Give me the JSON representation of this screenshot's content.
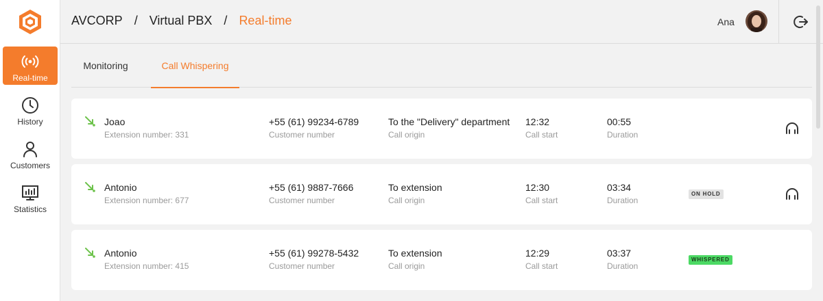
{
  "sidebar": {
    "logo": "avcorp-hexagon-logo",
    "items": [
      {
        "label": "Real-time",
        "icon": "broadcast-icon",
        "active": true
      },
      {
        "label": "History",
        "icon": "clock-icon",
        "active": false
      },
      {
        "label": "Customers",
        "icon": "user-icon",
        "active": false
      },
      {
        "label": "Statistics",
        "icon": "chart-monitor-icon",
        "active": false
      }
    ]
  },
  "header": {
    "breadcrumb": [
      "AVCORP",
      "Virtual PBX",
      "Real-time"
    ],
    "separator": "/",
    "user_name": "Ana",
    "logout_icon": "logout-icon"
  },
  "tabs": [
    {
      "label": "Monitoring",
      "active": false
    },
    {
      "label": "Call Whispering",
      "active": true
    }
  ],
  "calls": [
    {
      "name": "Joao",
      "extension": "Extension number: 331",
      "number": "+55 (61) 99234-6789",
      "number_label": "Customer number",
      "origin": "To the \"Delivery\" department",
      "origin_label": "Call origin",
      "start": "12:32",
      "start_label": "Call start",
      "duration": "00:55",
      "duration_label": "Duration",
      "status": "",
      "listen": true
    },
    {
      "name": "Antonio",
      "extension": "Extension number: 677",
      "number": "+55 (61) 9887-7666",
      "number_label": "Customer number",
      "origin": "To extension",
      "origin_label": "Call origin",
      "start": "12:30",
      "start_label": "Call start",
      "duration": "03:34",
      "duration_label": "Duration",
      "status": "ON HOLD",
      "listen": true
    },
    {
      "name": "Antonio",
      "extension": "Extension number: 415",
      "number": "+55 (61) 99278-5432",
      "number_label": "Customer number",
      "origin": "To extension",
      "origin_label": "Call origin",
      "start": "12:29",
      "start_label": "Call start",
      "duration": "03:37",
      "duration_label": "Duration",
      "status": "WHISPERED",
      "listen": false
    }
  ],
  "colors": {
    "accent": "#f47c2c",
    "incoming_arrow": "#6cc24a",
    "whispered_badge": "#4cd964",
    "hold_badge": "#e2e2e2"
  }
}
